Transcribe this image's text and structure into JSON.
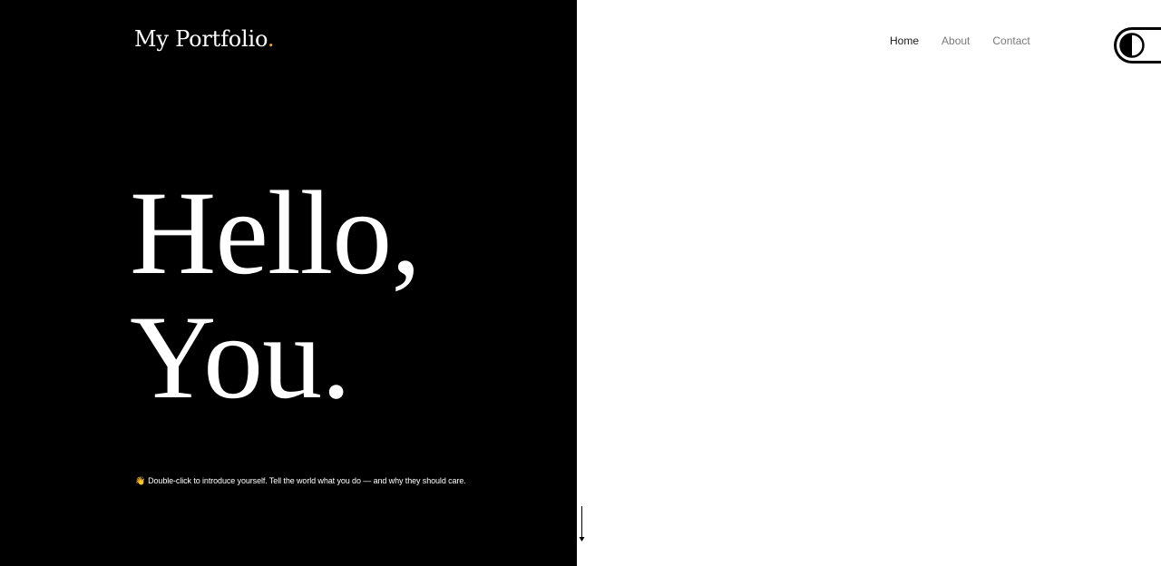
{
  "brand": {
    "name": "My Portfolio",
    "dot": ".",
    "dot_color": "#f5a623"
  },
  "nav": {
    "items": [
      {
        "label": "Home",
        "active": true
      },
      {
        "label": "About",
        "active": false
      },
      {
        "label": "Contact",
        "active": false
      }
    ]
  },
  "hero": {
    "line1": "Hello,",
    "line2": "You."
  },
  "tagline": {
    "emoji": "👋",
    "text": "Double-click to introduce yourself. Tell the world what you do — and why they should care."
  },
  "icons": {
    "theme_toggle": "contrast-icon",
    "scroll": "arrow-down-icon",
    "wave": "waving-hand-icon"
  },
  "colors": {
    "left_background": "#000000",
    "right_background": "#ffffff",
    "nav_active": "#1a1a1a",
    "nav_inactive": "#7a7a7a"
  }
}
